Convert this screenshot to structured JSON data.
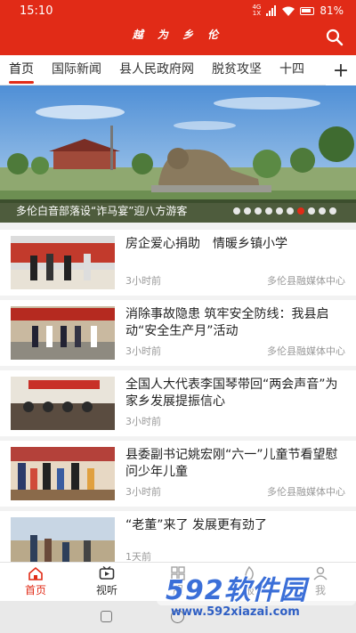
{
  "status": {
    "time": "15:10",
    "network": "4G",
    "battery": "81%"
  },
  "header": {
    "title": "越 为 乡 伦"
  },
  "tabs": [
    "首页",
    "国际新闻",
    "县人民政府网",
    "脱贫攻坚",
    "十四"
  ],
  "banner": {
    "caption": "多伦白音部落设“诈马宴”迎八方游客",
    "dot_count": 10,
    "active_dot": 7
  },
  "news": [
    {
      "title": "房企爱心捐助　情暖乡镇小学",
      "time": "3小时前",
      "source": "多伦县融媒体中心"
    },
    {
      "title": "消除事故隐患 筑牢安全防线：我县启动“安全生产月”活动",
      "time": "3小时前",
      "source": "多伦县融媒体中心"
    },
    {
      "title": "全国人大代表李国琴带回“两会声音”为家乡发展提振信心",
      "time": "3小时前",
      "source": ""
    },
    {
      "title": "县委副书记姚宏刚“六一”儿童节看望慰问少年儿童",
      "time": "3小时前",
      "source": "多伦县融媒体中心"
    },
    {
      "title": "“老董”来了 发展更有劲了",
      "time": "1天前",
      "source": ""
    }
  ],
  "bottom_nav": [
    {
      "label": "首页",
      "icon": "home-icon"
    },
    {
      "label": "视听",
      "icon": "tv-icon"
    },
    {
      "label": "服",
      "icon": "grid-icon"
    },
    {
      "label": "报",
      "icon": "fire-icon"
    },
    {
      "label": "我",
      "icon": "user-icon"
    }
  ],
  "watermark": {
    "brand": "592软件园",
    "url": "www.592xiazai.com"
  },
  "colors": {
    "accent": "#e12b17",
    "watermark": "#3b6fd8"
  }
}
